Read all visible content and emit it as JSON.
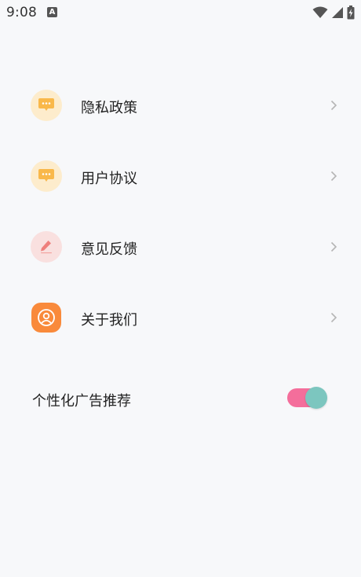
{
  "status_bar": {
    "time": "9:08",
    "notification_icon_text": "A",
    "icons": [
      "wifi-icon",
      "signal-icon",
      "battery-charging-icon"
    ]
  },
  "menu": {
    "items": [
      {
        "label": "隐私政策",
        "icon": "chat-bubble-icon",
        "icon_bg": "#fdeccc",
        "icon_fg": "#f9b84a"
      },
      {
        "label": "用户协议",
        "icon": "chat-bubble-icon",
        "icon_bg": "#fdeccc",
        "icon_fg": "#f9b84a"
      },
      {
        "label": "意见反馈",
        "icon": "pencil-edit-icon",
        "icon_bg": "#f9e0df",
        "icon_fg": "#ee7f7c"
      },
      {
        "label": "关于我们",
        "icon": "user-circle-icon",
        "icon_bg": "#f98a3b",
        "icon_fg": "#ffffff"
      }
    ]
  },
  "settings": {
    "personalized_ads_label": "个性化广告推荐",
    "personalized_ads_enabled": true,
    "toggle_colors": {
      "track": "#f46e9b",
      "knob": "#7cc6bf"
    }
  }
}
